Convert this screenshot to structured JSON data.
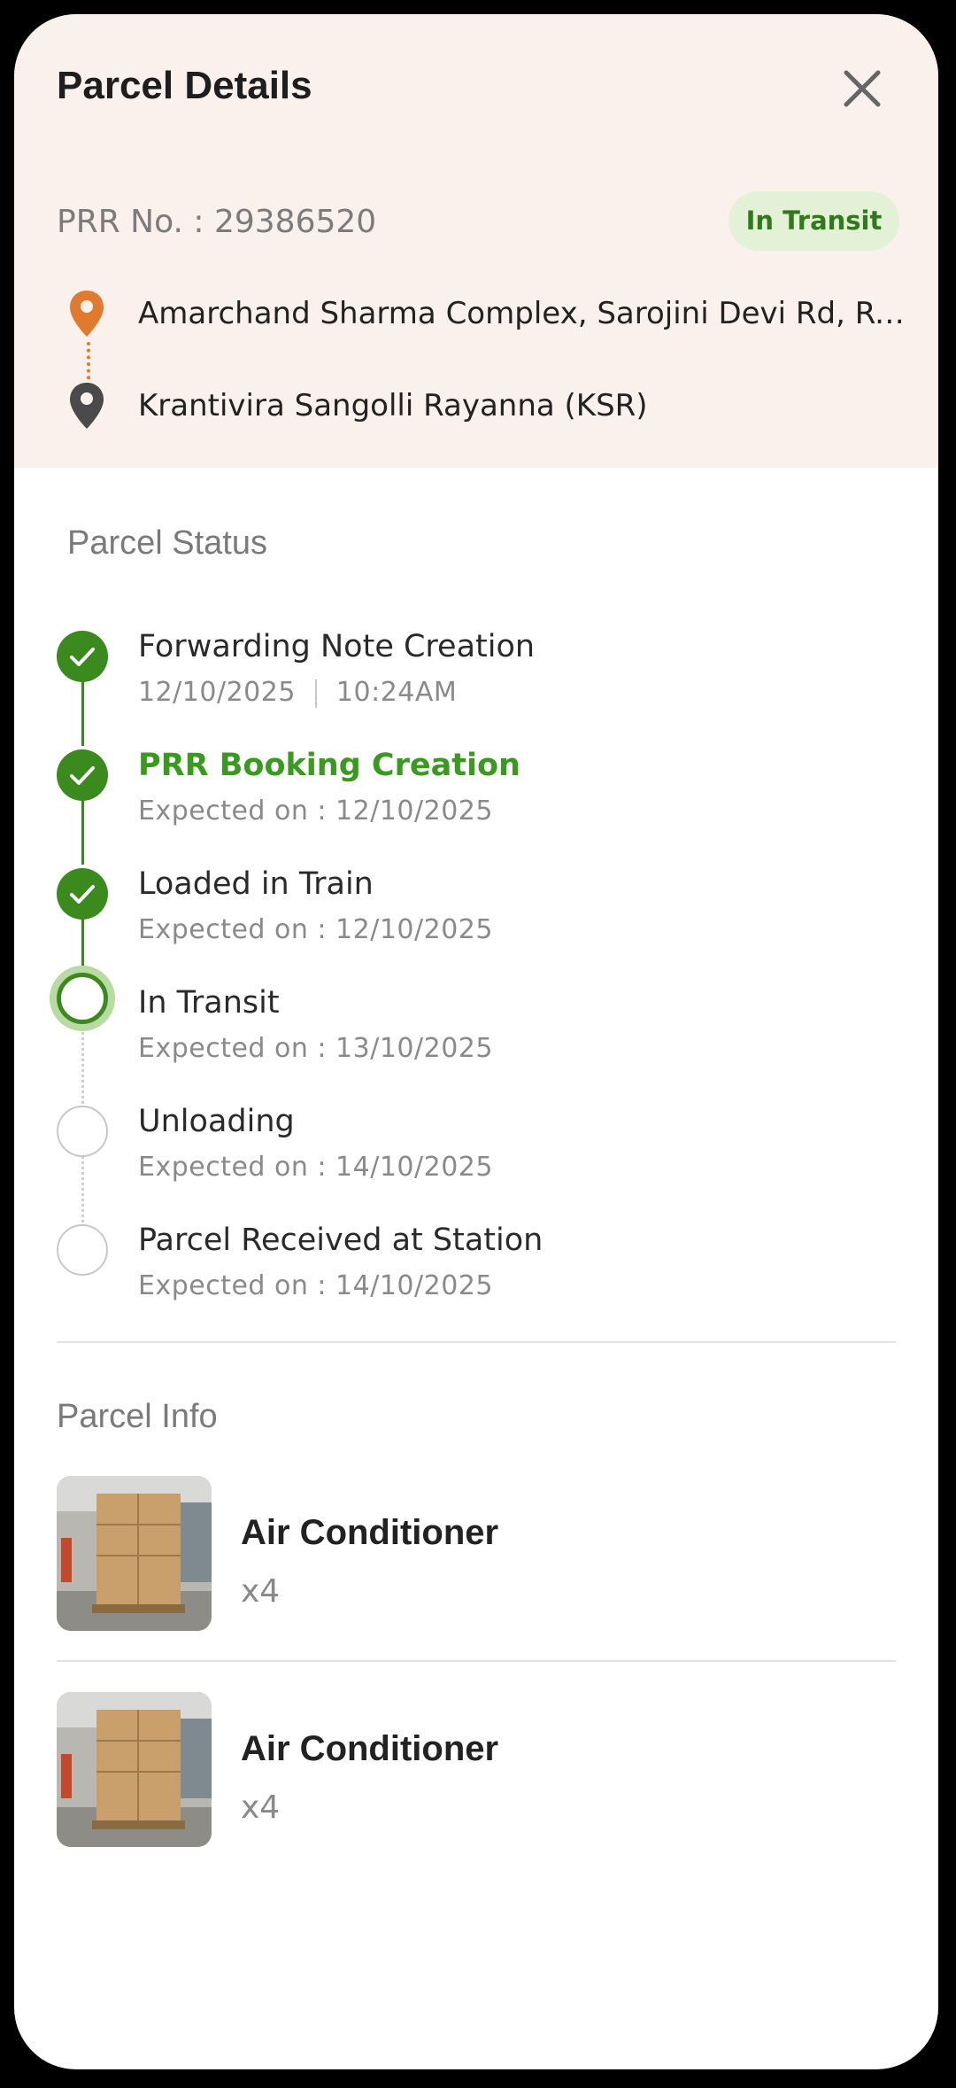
{
  "header": {
    "title": "Parcel Details",
    "prr_label": "PRR No. : 29386520",
    "status_badge": "In Transit",
    "origin": "Amarchand Sharma Complex, Sarojini Devi Rd, Re...",
    "destination": "Krantivira Sangolli Rayanna (KSR)"
  },
  "status": {
    "section_title": "Parcel Status",
    "steps": [
      {
        "title": "Forwarding Note Creation",
        "date": "12/10/2025",
        "time": "10:24AM",
        "state": "done"
      },
      {
        "title": "PRR Booking Creation",
        "sub": "Expected on : 12/10/2025",
        "state": "done"
      },
      {
        "title": "Loaded in Train",
        "sub": "Expected on : 12/10/2025",
        "state": "done"
      },
      {
        "title": "In Transit",
        "sub": "Expected on : 13/10/2025",
        "state": "current"
      },
      {
        "title": "Unloading",
        "sub": "Expected on : 14/10/2025",
        "state": "pending"
      },
      {
        "title": "Parcel Received at Station",
        "sub": "Expected on : 14/10/2025",
        "state": "pending"
      }
    ]
  },
  "parcel_info": {
    "section_title": "Parcel Info",
    "items": [
      {
        "name": "Air Conditioner",
        "qty": "x4"
      },
      {
        "name": "Air Conditioner",
        "qty": "x4"
      }
    ]
  },
  "colors": {
    "header_bg": "#fbf1ec",
    "accent_green": "#3a8a1e",
    "origin_pin": "#e07a2e",
    "destination_pin": "#4a4a4a"
  }
}
